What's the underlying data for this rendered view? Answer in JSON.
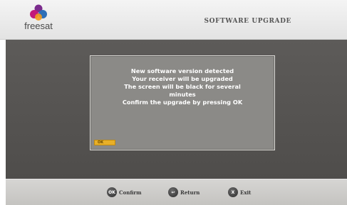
{
  "header": {
    "brand": "freesat",
    "title": "SOFTWARE UPGRADE"
  },
  "dialog": {
    "lines": [
      "New software version detected",
      "Your receiver will be upgraded",
      "The screen will be black for several",
      "minutes",
      "Confirm the upgrade by pressing OK"
    ],
    "ok_key": "OK"
  },
  "footer": {
    "buttons": [
      {
        "key": "OK",
        "label": "Confirm"
      },
      {
        "key": "↩",
        "label": "Return"
      },
      {
        "key": "X",
        "label": "Exit"
      }
    ]
  },
  "colors": {
    "background": "#545250",
    "dialog": "#8b8a87",
    "accent": "#e8b028",
    "logo_magenta": "#c2187a",
    "logo_blue": "#2e6fb7",
    "logo_orange": "#f39a1e",
    "logo_purple": "#7a2b8c"
  }
}
